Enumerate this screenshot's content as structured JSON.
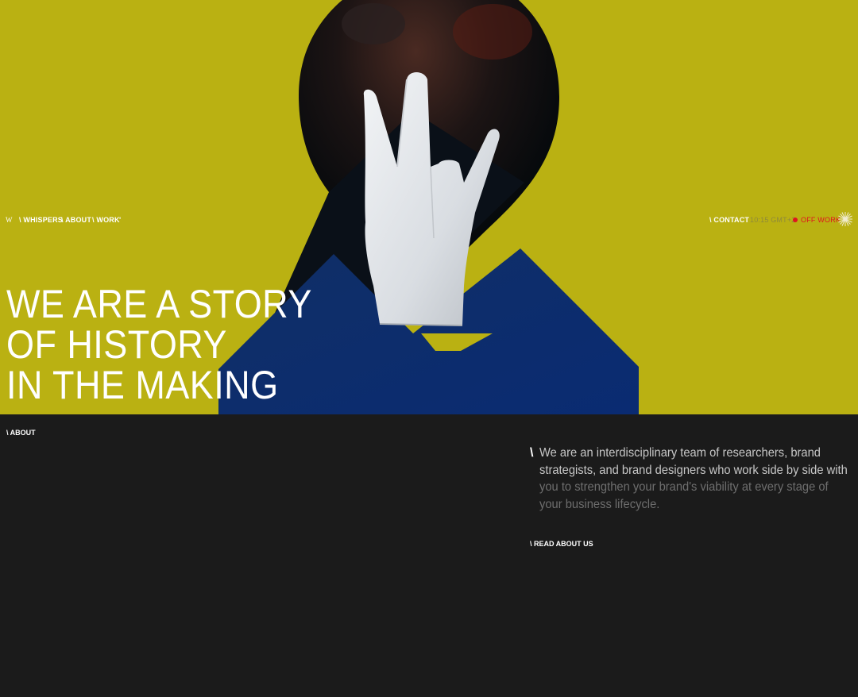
{
  "nav": {
    "logo": "W",
    "items": [
      "\\ WHISPERS",
      "\\ ABOUT",
      "\\ WORK"
    ],
    "tick": "'",
    "contact": "\\ CONTACT",
    "clock": "10:15 GMT+2",
    "status": "OFF WORK",
    "icon": "spark-icon"
  },
  "hero": {
    "headline": [
      "WE ARE A STORY",
      "OF HISTORY",
      "IN THE MAKING"
    ],
    "colors": {
      "background": "#bab112",
      "blue": "#0d3273",
      "dark": "#1b1b1b"
    }
  },
  "about": {
    "section_label": "\\ ABOUT",
    "slash": "\\",
    "lines": [
      "We are an interdisciplinary team of researchers, brand",
      "strategists, and brand designers who work side by side with",
      "you to strengthen your brand's viability at every stage of",
      "your business lifecycle."
    ],
    "cta": "\\ READ ABOUT US"
  }
}
